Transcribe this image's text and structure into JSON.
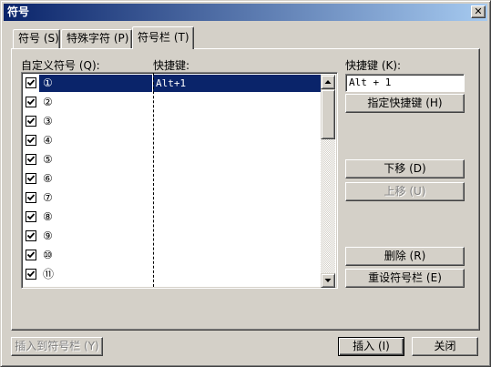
{
  "window": {
    "title": "符号",
    "close_glyph": "✕"
  },
  "tabs": [
    {
      "label": "符号 (S)"
    },
    {
      "label": "特殊字符 (P)"
    },
    {
      "label": "符号栏 (T)",
      "active": true
    }
  ],
  "list": {
    "symbol_header": "自定义符号 (Q):",
    "shortcut_header": "快捷键:",
    "rows": [
      {
        "symbol": "①",
        "shortcut": "Alt+1",
        "checked": true,
        "selected": true
      },
      {
        "symbol": "②",
        "shortcut": "",
        "checked": true
      },
      {
        "symbol": "③",
        "shortcut": "",
        "checked": true
      },
      {
        "symbol": "④",
        "shortcut": "",
        "checked": true
      },
      {
        "symbol": "⑤",
        "shortcut": "",
        "checked": true
      },
      {
        "symbol": "⑥",
        "shortcut": "",
        "checked": true
      },
      {
        "symbol": "⑦",
        "shortcut": "",
        "checked": true
      },
      {
        "symbol": "⑧",
        "shortcut": "",
        "checked": true
      },
      {
        "symbol": "⑨",
        "shortcut": "",
        "checked": true
      },
      {
        "symbol": "⑩",
        "shortcut": "",
        "checked": true
      },
      {
        "symbol": "⑪",
        "shortcut": "",
        "checked": true
      }
    ]
  },
  "shortcut": {
    "label": "快捷键 (K):",
    "value": "Alt + 1",
    "assign_button": "指定快捷键 (H)"
  },
  "actions": {
    "move_down": "下移 (D)",
    "move_up": "上移 (U)",
    "delete": "删除 (R)",
    "reset": "重设符号栏 (E)"
  },
  "footer": {
    "insert_to_bar": "插入到符号栏 (Y)",
    "insert": "插入 (I)",
    "close": "关闭"
  },
  "colors": {
    "selection": "#0a246a",
    "face": "#d4d0c8",
    "title_gradient_start": "#0a246a",
    "title_gradient_end": "#a6caf0"
  }
}
